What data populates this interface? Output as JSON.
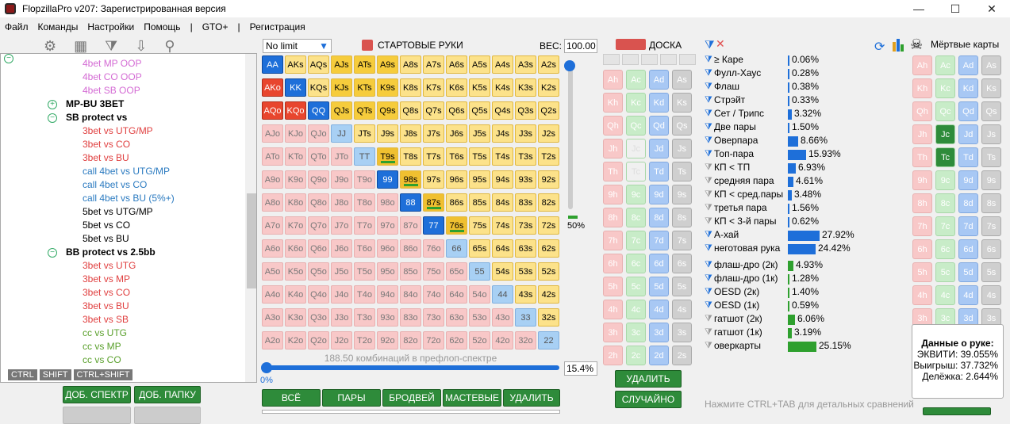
{
  "title": "FlopzillaPro v207: Зарегистрированная версия",
  "menu": [
    "Файл",
    "Команды",
    "Настройки",
    "Помощь",
    "|",
    "GTO+",
    "|",
    "Регистрация"
  ],
  "tree": [
    {
      "t": "4bet MP OOP",
      "c": "#d46bd4",
      "i": 2
    },
    {
      "t": "4bet CO OOP",
      "c": "#d46bd4",
      "i": 2
    },
    {
      "t": "4bet SB OOP",
      "c": "#d46bd4",
      "i": 2
    },
    {
      "t": "MP-BU 3BET",
      "c": "#000",
      "i": 1,
      "b": true,
      "ico": "+"
    },
    {
      "t": "SB protect vs",
      "c": "#000",
      "i": 1,
      "b": true,
      "ico": "-"
    },
    {
      "t": "3bet vs UTG/MP",
      "c": "#e04040",
      "i": 2
    },
    {
      "t": "3bet vs CO",
      "c": "#e04040",
      "i": 2
    },
    {
      "t": "3bet vs BU",
      "c": "#e04040",
      "i": 2
    },
    {
      "t": "call 4bet vs UTG/MP",
      "c": "#2a7ac0",
      "i": 2
    },
    {
      "t": "call 4bet vs CO",
      "c": "#2a7ac0",
      "i": 2
    },
    {
      "t": "call 4bet vs BU (5%+)",
      "c": "#2a7ac0",
      "i": 2
    },
    {
      "t": "5bet vs UTG/MP",
      "c": "#000",
      "i": 2
    },
    {
      "t": "5bet vs CO",
      "c": "#000",
      "i": 2
    },
    {
      "t": "5bet vs BU",
      "c": "#000",
      "i": 2
    },
    {
      "t": "BB protect vs 2.5bb",
      "c": "#000",
      "i": 1,
      "b": true,
      "ico": "-"
    },
    {
      "t": "3bet vs UTG",
      "c": "#e04040",
      "i": 2
    },
    {
      "t": "3bet vs MP",
      "c": "#e04040",
      "i": 2
    },
    {
      "t": "3bet vs CO",
      "c": "#e04040",
      "i": 2
    },
    {
      "t": "3bet vs BU",
      "c": "#e04040",
      "i": 2
    },
    {
      "t": "3bet vs SB",
      "c": "#e04040",
      "i": 2
    },
    {
      "t": "cc vs UTG",
      "c": "#5aa02c",
      "i": 2
    },
    {
      "t": "cc vs MP",
      "c": "#5aa02c",
      "i": 2
    },
    {
      "t": "cc vs CO",
      "c": "#5aa02c",
      "i": 2
    }
  ],
  "modkeys": [
    "CTRL",
    "SHIFT",
    "CTRL+SHIFT"
  ],
  "left_buttons": {
    "add_spectr": "ДОБ. СПЕКТР",
    "add_folder": "ДОБ. ПАПКУ"
  },
  "limit": "No limit",
  "start_hands": "СТАРТОВЫЕ РУКИ",
  "weight_label": "ВЕС:",
  "weight": "100.00",
  "slider_pct": "50%",
  "combos_text": "188.50 комбинаций в префлоп-спектре",
  "range_pct": "15.4%",
  "range_min": "0%",
  "bottom_buttons": [
    "ВСЁ",
    "ПАРЫ",
    "БРОДВЕЙ",
    "МАСТЕВЫЕ",
    "УДАЛИТЬ"
  ],
  "board_title": "ДОСКА",
  "board_buttons": {
    "delete": "УДАЛИТЬ",
    "random": "СЛУЧАЙНО"
  },
  "dead_title": "Мёртвые карты",
  "stats": [
    {
      "n": "≥ Каре",
      "v": "0.06%",
      "p": 0.06,
      "c": "#1e6fd9",
      "f": "#1e6fd9"
    },
    {
      "n": "Фулл-Хаус",
      "v": "0.28%",
      "p": 0.28,
      "c": "#1e6fd9",
      "f": "#1e6fd9"
    },
    {
      "n": "Флаш",
      "v": "0.38%",
      "p": 0.38,
      "c": "#1e6fd9",
      "f": "#1e6fd9"
    },
    {
      "n": "Стрэйт",
      "v": "0.33%",
      "p": 0.33,
      "c": "#1e6fd9",
      "f": "#1e6fd9"
    },
    {
      "n": "Сет / Трипс",
      "v": "3.32%",
      "p": 3.32,
      "c": "#1e6fd9",
      "f": "#1e6fd9"
    },
    {
      "n": "Две пары",
      "v": "1.50%",
      "p": 1.5,
      "c": "#1e6fd9",
      "f": "#1e6fd9"
    },
    {
      "n": "Оверпара",
      "v": "8.66%",
      "p": 8.66,
      "c": "#1e6fd9",
      "f": "#1e6fd9"
    },
    {
      "n": "Топ-пара",
      "v": "15.93%",
      "p": 15.93,
      "c": "#1e6fd9",
      "f": "#1e6fd9"
    },
    {
      "n": "КП < ТП",
      "v": "6.93%",
      "p": 6.93,
      "c": "#1e6fd9",
      "f": "#999"
    },
    {
      "n": "средняя пара",
      "v": "4.61%",
      "p": 4.61,
      "c": "#1e6fd9",
      "f": "#999"
    },
    {
      "n": "КП < сред.пары",
      "v": "3.48%",
      "p": 3.48,
      "c": "#1e6fd9",
      "f": "#999"
    },
    {
      "n": "третья пара",
      "v": "1.56%",
      "p": 1.56,
      "c": "#1e6fd9",
      "f": "#999"
    },
    {
      "n": "КП < 3-й пары",
      "v": "0.62%",
      "p": 0.62,
      "c": "#1e6fd9",
      "f": "#999"
    },
    {
      "n": "А-хай",
      "v": "27.92%",
      "p": 27.92,
      "c": "#1e6fd9",
      "f": "#1e6fd9"
    },
    {
      "n": "неготовая рука",
      "v": "24.42%",
      "p": 24.42,
      "c": "#1e6fd9",
      "f": "#1e6fd9"
    },
    {
      "n": "флаш-дро (2к)",
      "v": "4.93%",
      "p": 4.93,
      "c": "#2ea02e",
      "f": "#1e6fd9"
    },
    {
      "n": "флаш-дро (1к)",
      "v": "1.28%",
      "p": 1.28,
      "c": "#2ea02e",
      "f": "#1e6fd9"
    },
    {
      "n": "OESD (2к)",
      "v": "1.40%",
      "p": 1.4,
      "c": "#2ea02e",
      "f": "#1e6fd9"
    },
    {
      "n": "OESD (1к)",
      "v": "0.59%",
      "p": 0.59,
      "c": "#2ea02e",
      "f": "#1e6fd9"
    },
    {
      "n": "гатшот (2к)",
      "v": "6.06%",
      "p": 6.06,
      "c": "#2ea02e",
      "f": "#999"
    },
    {
      "n": "гатшот (1к)",
      "v": "3.19%",
      "p": 3.19,
      "c": "#2ea02e",
      "f": "#999"
    },
    {
      "n": "оверкарты",
      "v": "25.15%",
      "p": 25.15,
      "c": "#2ea02e",
      "f": "#999"
    }
  ],
  "hand_data": {
    "title": "Данные о руке:",
    "equity": "ЭКВИТИ: 39.055%",
    "wins": "Выигрыш: 37.732%",
    "ties": "Делёжка: 2.644%"
  },
  "hint": "Нажмите CTRL+TAB для детальных сравнений",
  "grid_ranks": [
    "A",
    "K",
    "Q",
    "J",
    "T",
    "9",
    "8",
    "7",
    "6",
    "5",
    "4",
    "3",
    "2"
  ],
  "grid_state": [
    "BYYYYYYYYYYYY",
    "RBYYYYYYYYYYY",
    "RRBYYYYYYYYYY",
    "PPPLYYYYYYYYY",
    "PPPPLYYYYYYYY",
    "PPPPPBYYYYYYY",
    "PPPPPPBYYYYYY",
    "PPPPPPPBYYYYY",
    "PPPPPPPPLYYYY",
    "PPPPPPPPPLYYY",
    "PPPPPPPPPPLYY",
    "PPPPPPPPPPPLY",
    "PPPPPPPPPPPPL"
  ],
  "board_suits": [
    "h",
    "c",
    "d",
    "s"
  ],
  "board_selected": [
    "Jc",
    "Tc"
  ],
  "dead_selected": [
    "Jc",
    "Tc"
  ]
}
